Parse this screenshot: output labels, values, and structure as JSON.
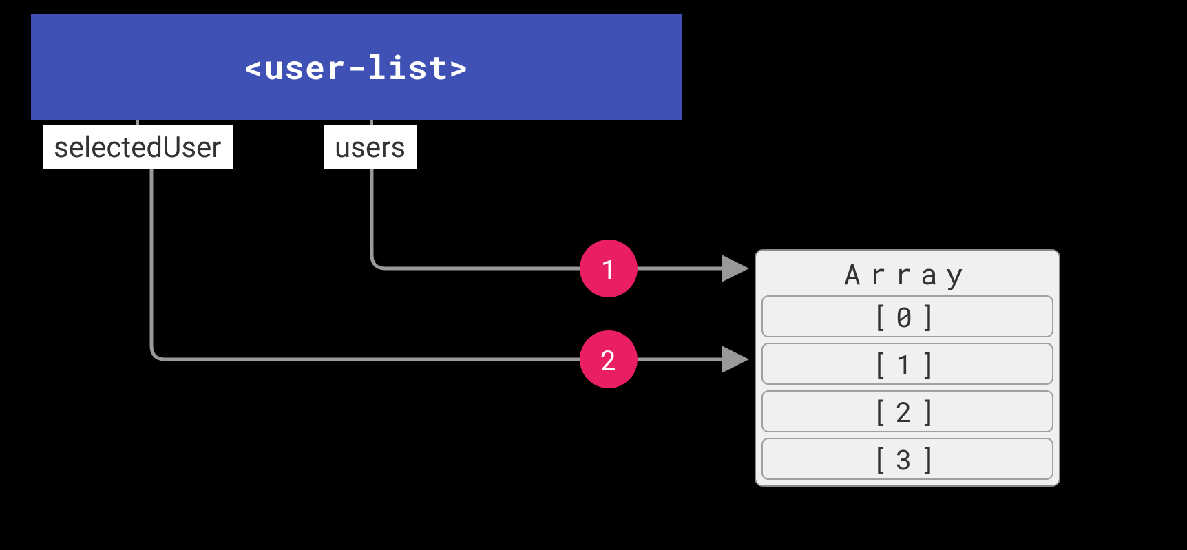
{
  "component": {
    "title": "<user-list>",
    "properties": {
      "selectedUser": "selectedUser",
      "users": "users"
    }
  },
  "array": {
    "header": "Array",
    "items": [
      "[0]",
      "[1]",
      "[2]",
      "[3]"
    ]
  },
  "badges": {
    "b1": "1",
    "b2": "2"
  },
  "colors": {
    "component_bg": "#3f51b5",
    "badge_bg": "#e91e63",
    "stroke": "#999999",
    "array_bg": "#f0f0f0"
  }
}
